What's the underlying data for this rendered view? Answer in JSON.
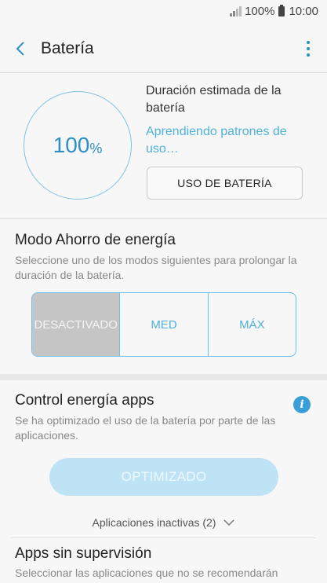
{
  "status_bar": {
    "battery_percent": "100%",
    "time": "10:00"
  },
  "app_bar": {
    "title": "Batería"
  },
  "battery": {
    "percent_number": "100",
    "percent_sign": "%",
    "estimate_label": "Duración estimada de la batería",
    "learning_text": "Aprendiendo patrones de uso…",
    "usage_button": "USO DE BATERÍA"
  },
  "power_saving": {
    "title": "Modo Ahorro de energía",
    "description": "Seleccione uno de los modos siguientes para prolongar la duración de la batería.",
    "modes": [
      "DESACTIVADO",
      "MED",
      "MÁX"
    ],
    "selected": "DESACTIVADO"
  },
  "app_power": {
    "title": "Control energía apps",
    "description": "Se ha optimizado el uso de la batería por parte de las aplicaciones.",
    "button": "OPTIMIZADO",
    "inactive_apps": "Aplicaciones inactivas (2)"
  },
  "unsupervised": {
    "title": "Apps sin supervisión",
    "description": "Seleccionar las aplicaciones que no se recomendarán"
  },
  "colors": {
    "accent": "#2c8fc7",
    "light_accent": "#4fb1dc",
    "disabled_button": "#bde3f5"
  },
  "icons": [
    "signal-icon",
    "battery-icon",
    "back-arrow-icon",
    "more-options-icon",
    "info-icon",
    "chevron-down-icon"
  ]
}
